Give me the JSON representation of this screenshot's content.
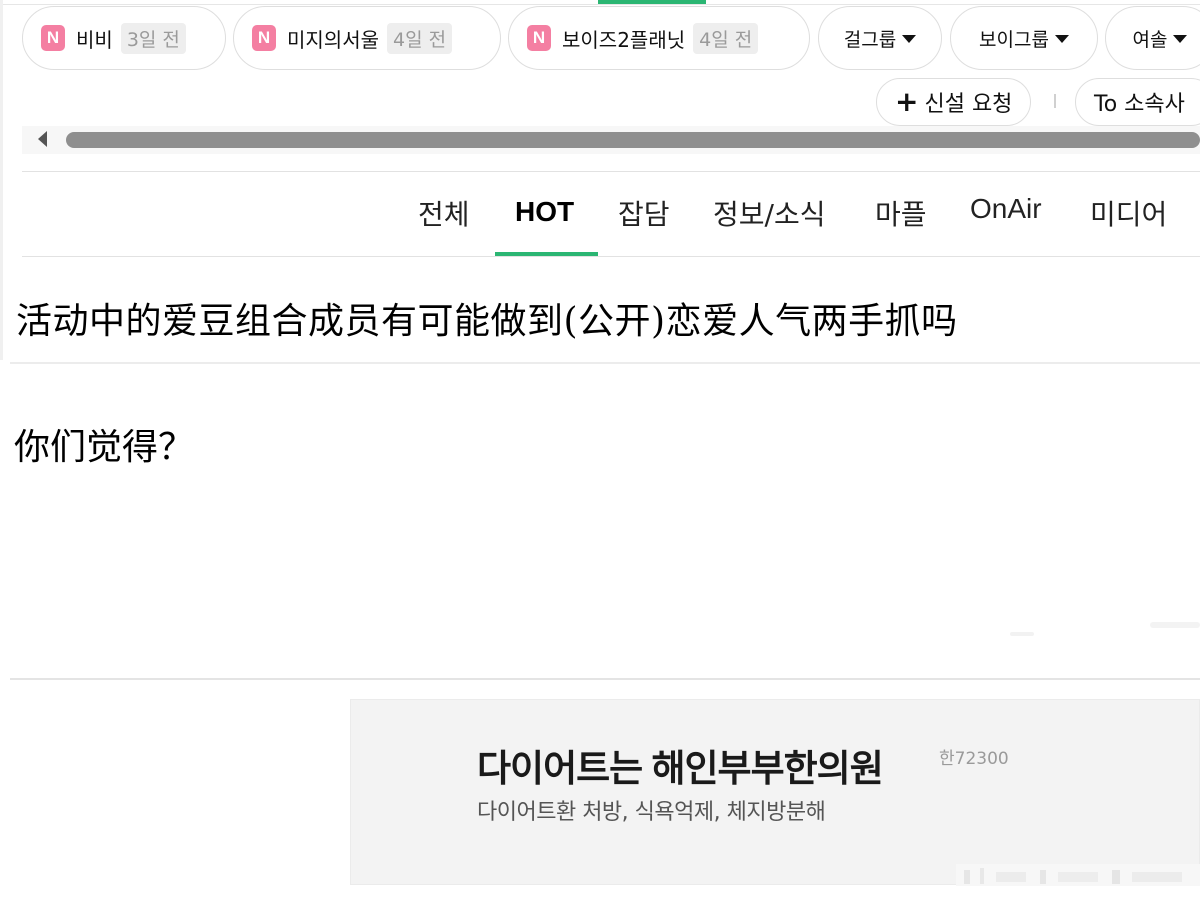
{
  "channels": [
    {
      "badge": "N",
      "name": "비비",
      "time": "3일 전"
    },
    {
      "badge": "N",
      "name": "미지의서울",
      "time": "4일 전"
    },
    {
      "badge": "N",
      "name": "보이즈2플래닛",
      "time": "4일 전"
    }
  ],
  "category_dropdowns": [
    "걸그룹",
    "보이그룹",
    "여솔"
  ],
  "actions": {
    "new_request": "신설 요청",
    "to_agency": "To 소속사"
  },
  "tabs": [
    "전체",
    "HOT",
    "잡담",
    "정보/소식",
    "마플",
    "OnAir",
    "미디어"
  ],
  "active_tab": "HOT",
  "post": {
    "headline": "活动中的爱豆组合成员有可能做到(公开)恋爱人气两手抓吗",
    "question": "你们觉得？"
  },
  "ad": {
    "title": "다이어트는 해인부부한의원",
    "code": "한72300",
    "subtitle": "다이어트환 처방, 식욕억제, 체지방분해"
  },
  "colors": {
    "accent": "#2bb673",
    "badge": "#f47fa2"
  }
}
